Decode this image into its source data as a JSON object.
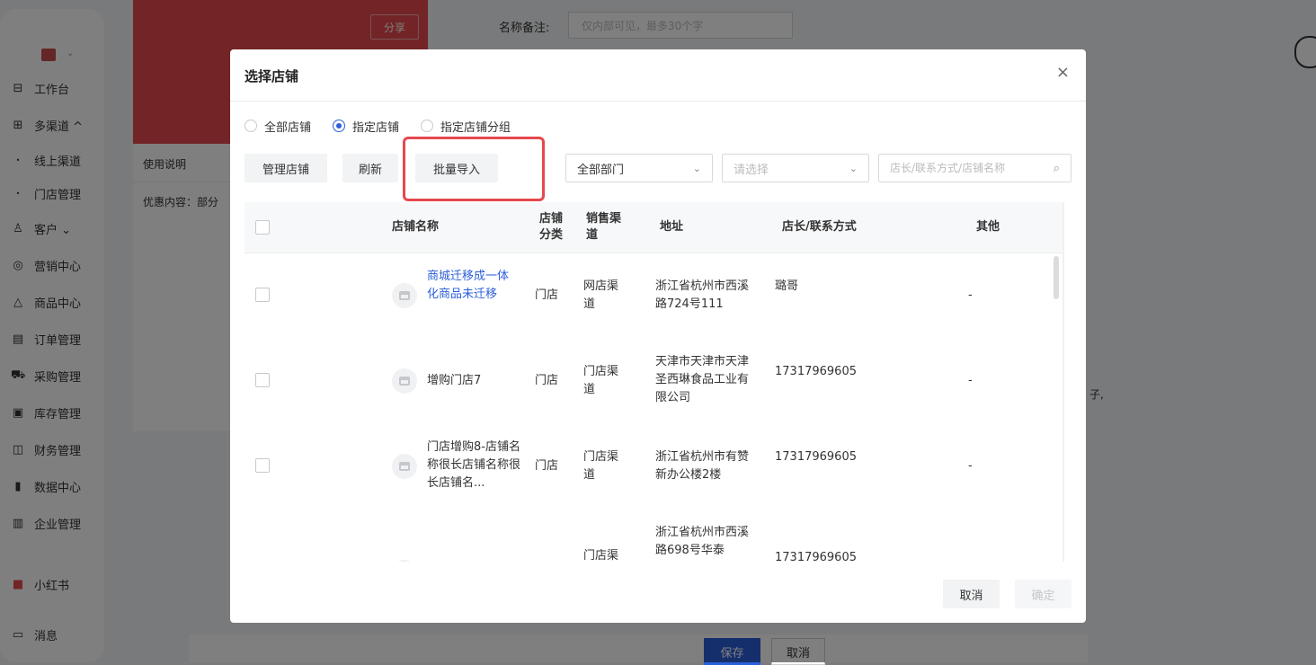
{
  "sidebar": {
    "items": [
      {
        "icon": "workbench-icon",
        "glyph": "⊟",
        "label": "工作台"
      },
      {
        "icon": "multichannel-icon",
        "glyph": "⊞",
        "label": "多渠道 ^"
      },
      {
        "icon": "bullet-icon",
        "glyph": "•",
        "label": "线上渠道",
        "sub": true
      },
      {
        "icon": "bullet-icon",
        "glyph": "•",
        "label": "门店管理",
        "sub": true
      },
      {
        "icon": "customer-icon",
        "glyph": "♙",
        "label": "客户 ⌄"
      },
      {
        "icon": "marketing-icon",
        "glyph": "◎",
        "label": "营销中心"
      },
      {
        "icon": "goods-icon",
        "glyph": "△",
        "label": "商品中心"
      },
      {
        "icon": "order-icon",
        "glyph": "▤",
        "label": "订单管理"
      },
      {
        "icon": "cart-icon",
        "glyph": "⛟",
        "label": "采购管理"
      },
      {
        "icon": "warehouse-icon",
        "glyph": "▣",
        "label": "库存管理"
      },
      {
        "icon": "finance-icon",
        "glyph": "◫",
        "label": "财务管理"
      },
      {
        "icon": "data-icon",
        "glyph": "▮",
        "label": "数据中心"
      },
      {
        "icon": "enterprise-icon",
        "glyph": "▥",
        "label": "企业管理"
      },
      {
        "icon": "xiaohongshu-icon",
        "glyph": "■",
        "label": "小红书",
        "red": true
      },
      {
        "icon": "message-icon",
        "glyph": "▭",
        "label": "消息"
      }
    ]
  },
  "background": {
    "share_label": "分享",
    "remark_label": "名称备注:",
    "remark_placeholder": "仅内部可见，最多30个字",
    "card_line1": "使用说明",
    "card_line2": "优惠内容：部分",
    "save_label": "保存",
    "cancel_label": "取消",
    "dot_text": "子,"
  },
  "modal": {
    "title": "选择店铺",
    "close_glyph": "×",
    "radios": [
      {
        "label": "全部店铺",
        "checked": false
      },
      {
        "label": "指定店铺",
        "checked": true
      },
      {
        "label": "指定店铺分组",
        "checked": false
      }
    ],
    "buttons": {
      "manage": "管理店铺",
      "refresh": "刷新",
      "batch_import": "批量导入"
    },
    "dept_select": "全部部门",
    "second_select_placeholder": "请选择",
    "search_placeholder": "店长/联系方式/店铺名称",
    "columns": {
      "name": "店铺名称",
      "category": "店铺分类",
      "channel": "销售渠道",
      "address": "地址",
      "manager": "店长/联系方式",
      "other": "其他"
    },
    "rows": [
      {
        "name": "商城迁移成一体化商品未迁移",
        "link": true,
        "category": "门店",
        "channel": "网店渠道",
        "address": "浙江省杭州市西溪路724号111",
        "manager": "璐哥",
        "other": "-"
      },
      {
        "name": "增购门店7",
        "link": false,
        "category": "门店",
        "channel": "门店渠道",
        "address": "天津市天津市天津圣西琳食品工业有限公司",
        "manager": "17317969605",
        "other": "-"
      },
      {
        "name": "门店增购8-店铺名称很长店铺名称很长店铺名...",
        "link": false,
        "category": "门店",
        "channel": "门店渠道",
        "address": "浙江省杭州市有赞新办公楼2楼",
        "manager": "17317969605",
        "other": "-"
      },
      {
        "name": "",
        "link": false,
        "category": "",
        "channel": "门店渠道",
        "address": "浙江省杭州市西溪路698号华泰",
        "manager": "17317969605",
        "other": ""
      }
    ],
    "footer": {
      "cancel": "取消",
      "ok": "确定"
    }
  }
}
